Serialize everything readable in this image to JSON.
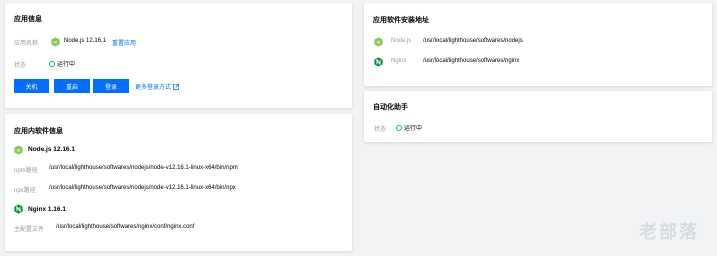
{
  "app_info": {
    "title": "应用信息",
    "name_label": "应用名称",
    "name_value": "Node.js 12.16.1",
    "reset_link": "重置应用",
    "status_label": "状态",
    "status_value": "运行中",
    "buttons": {
      "shutdown": "关机",
      "restart": "重启",
      "login": "登录"
    },
    "more_login": "更多登录方式"
  },
  "software_info": {
    "title": "应用内软件信息",
    "node": {
      "name": "Node.js 12.16.1",
      "npm_label": "npm路径",
      "npm_path": "/usr/local/lighthouse/softwares/nodejs/node-v12.16.1-linux-x64/bin/npm",
      "npx_label": "npx路径",
      "npx_path": "/usr/local/lighthouse/softwares/nodejs/node-v12.16.1-linux-x64/bin/npx"
    },
    "nginx": {
      "name": "Nginx 1.16.1",
      "conf_label": "主配置文件",
      "conf_path": "/usr/local/lighthouse/softwares/nginx/conf/nginx.conf"
    }
  },
  "install_paths": {
    "title": "应用软件安装地址",
    "items": [
      {
        "name": "Node.js",
        "path": "/usr/local/lighthouse/softwares/nodejs",
        "icon": "nodejs-icon"
      },
      {
        "name": "Nginx",
        "path": "/usr/local/lighthouse/softwares/nginx",
        "icon": "nginx-icon"
      }
    ]
  },
  "automation": {
    "title": "自动化助手",
    "status_label": "状态",
    "status_value": "运行中"
  },
  "colors": {
    "primary": "#006eff",
    "status_green": "#0abf5b",
    "node_green": "#8cc84b",
    "nginx_green": "#009639"
  },
  "watermark": "老部落"
}
